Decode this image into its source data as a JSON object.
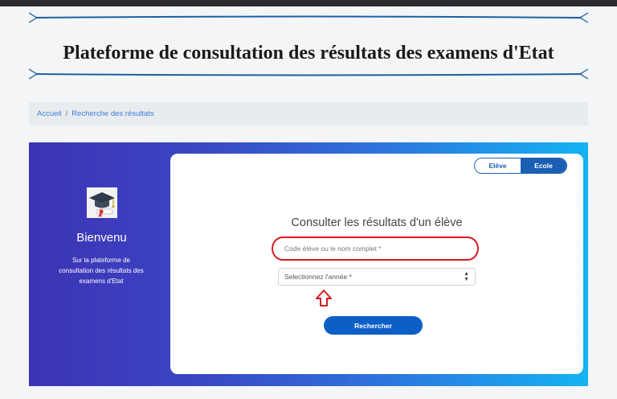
{
  "page": {
    "title": "Plateforme de consultation des résultats des examens d'Etat"
  },
  "breadcrumb": {
    "home": "Accueil",
    "separator": "/",
    "current": "Recherche des résultats"
  },
  "sidebar": {
    "welcome_title": "Bienvenu",
    "welcome_text": "Sur la plateforme de consultation des résultats des examens d'Etat",
    "logo_icon": "graduation-cap-diploma-icon"
  },
  "search_card": {
    "toggle": {
      "options": [
        "Elève",
        "Ecole"
      ],
      "active": "Ecole"
    },
    "title": "Consulter les résultats d'un élève",
    "student_input": {
      "value": "",
      "placeholder": "Code élève ou le nom complet *"
    },
    "year_select": {
      "selected": "Selectionnez l'année *"
    },
    "search_button": "Rechercher"
  },
  "colors": {
    "accent": "#1a5fb4",
    "button": "#0d5fc8",
    "annotation_red": "#d71920",
    "gradient_start": "#3d33b4",
    "gradient_end": "#14b3f2"
  }
}
